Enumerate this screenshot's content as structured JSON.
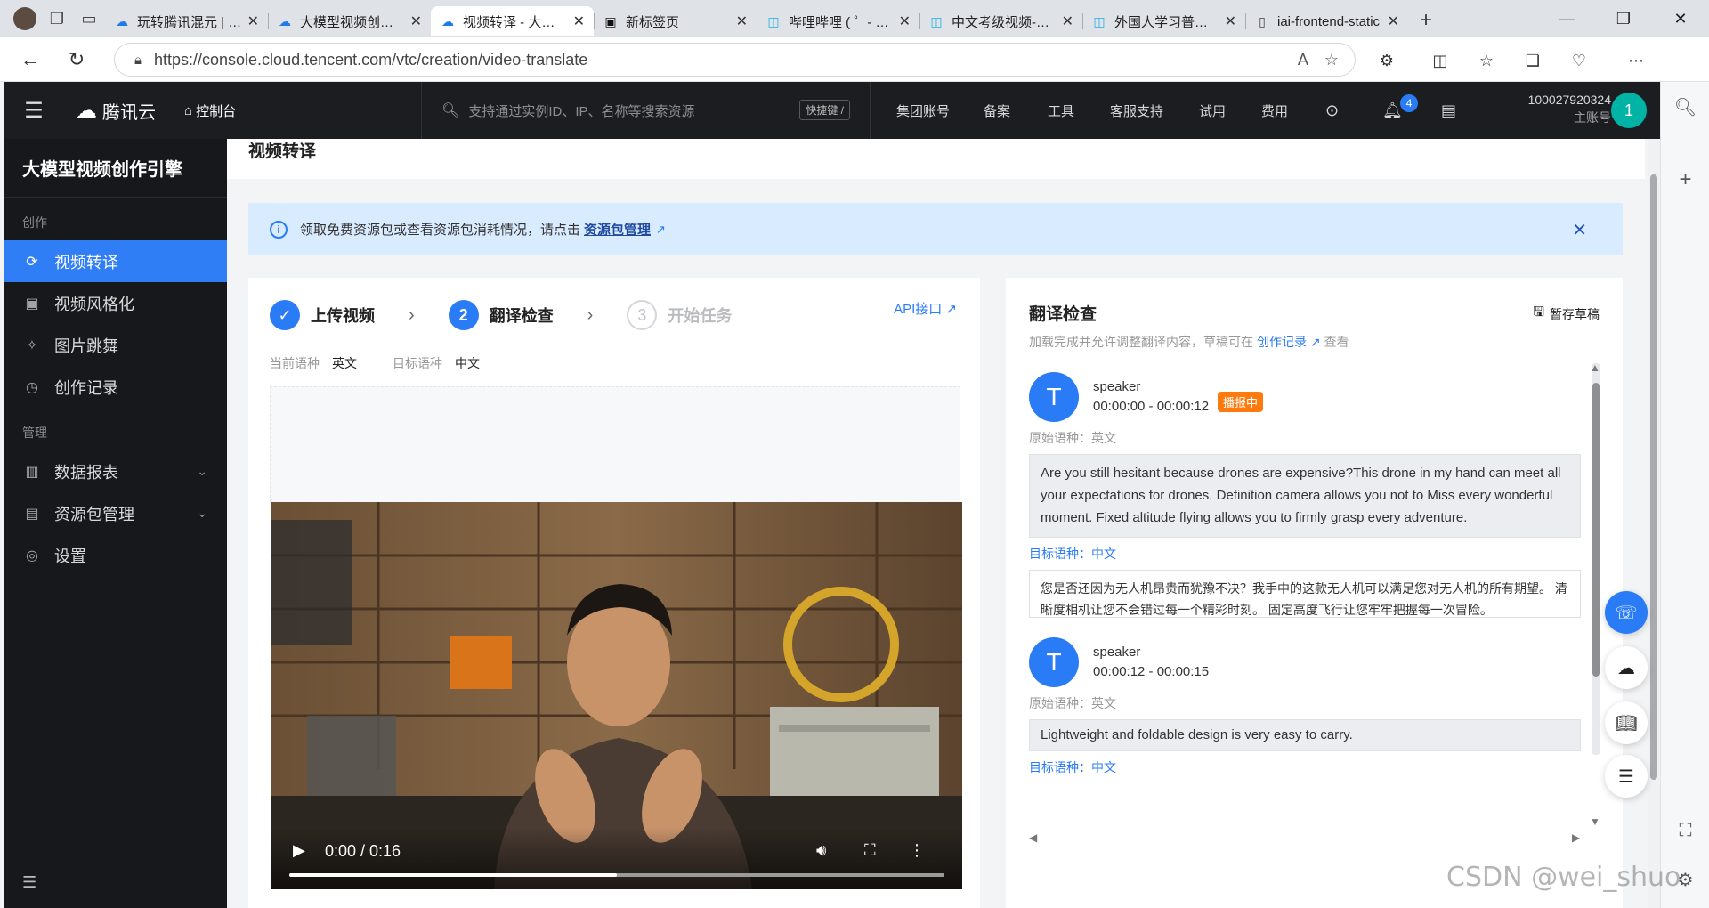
{
  "browser": {
    "tabs": [
      {
        "title": "玩转腾讯混元 | 腾讯云",
        "active": false
      },
      {
        "title": "大模型视频创作引擎",
        "active": false
      },
      {
        "title": "视频转译 - 大模型视频创作引擎",
        "active": true
      },
      {
        "title": "新标签页",
        "active": false
      },
      {
        "title": "哔哩哔哩 ( ゜- ゜)つロ",
        "active": false
      },
      {
        "title": "中文考级视频-哔哩哔哩",
        "active": false
      },
      {
        "title": "外国人学习普通话",
        "active": false
      },
      {
        "title": "iai-frontend-static",
        "active": false
      }
    ],
    "url": "https://console.cloud.tencent.com/vtc/creation/video-translate"
  },
  "header": {
    "logo_text": "腾讯云",
    "console_label": "控制台",
    "search_placeholder": "支持通过实例ID、IP、名称等搜索资源",
    "shortcut_label": "快捷键 /",
    "nav": [
      "集团账号",
      "备案",
      "工具",
      "客服支持",
      "试用",
      "费用"
    ],
    "notification_count": "4",
    "account_id": "100027920324",
    "account_role": "主账号",
    "avatar_letter": "1"
  },
  "sidebar": {
    "product_name": "大模型视频创作引擎",
    "group_create": "创作",
    "group_manage": "管理",
    "items": [
      {
        "label": "视频转译",
        "icon": "translate-icon",
        "active": true
      },
      {
        "label": "视频风格化",
        "icon": "video-style-icon",
        "active": false
      },
      {
        "label": "图片跳舞",
        "icon": "dance-icon",
        "active": false
      },
      {
        "label": "创作记录",
        "icon": "history-icon",
        "active": false
      },
      {
        "label": "数据报表",
        "icon": "bar-chart-icon",
        "active": false
      },
      {
        "label": "资源包管理",
        "icon": "package-icon",
        "active": false
      },
      {
        "label": "设置",
        "icon": "settings-icon",
        "active": false
      }
    ]
  },
  "page": {
    "title": "视频转译",
    "notice_text": "领取免费资源包或查看资源包消耗情况，请点击",
    "notice_link": "资源包管理"
  },
  "workflow": {
    "steps": [
      {
        "num": "✓",
        "label": "上传视频",
        "state": "done"
      },
      {
        "num": "2",
        "label": "翻译检查",
        "state": "current"
      },
      {
        "num": "3",
        "label": "开始任务",
        "state": "todo"
      }
    ],
    "api_link": "API接口",
    "source_lang_label": "当前语种",
    "source_lang": "英文",
    "target_lang_label": "目标语种",
    "target_lang": "中文"
  },
  "video": {
    "time": "0:00 / 0:16",
    "progress": 0.5
  },
  "translation": {
    "title": "翻译检查",
    "save_draft": "暂存草稿",
    "subtitle_prefix": "加载完成并允许调整翻译内容，草稿可在",
    "subtitle_link": "创作记录",
    "subtitle_suffix": "查看",
    "segments": [
      {
        "avatar": "T",
        "speaker": "speaker",
        "time": "00:00:00 - 00:00:12",
        "tag": "播报中",
        "source_label": "原始语种：英文",
        "source_text": "Are you still hesitant because drones are expensive?This drone in my hand can meet all your expectations for drones. Definition camera allows you not to Miss every wonderful moment. Fixed altitude flying allows you to firmly grasp every adventure.",
        "target_label": "目标语种：中文",
        "target_text": "您是否还因为无人机昂贵而犹豫不决？我手中的这款无人机可以满足您对无人机的所有期望。 清晰度相机让您不会错过每一个精彩时刻。 固定高度飞行让您牢牢把握每一次冒险。"
      },
      {
        "avatar": "T",
        "speaker": "speaker",
        "time": "00:00:12 - 00:00:15",
        "source_label": "原始语种：英文",
        "source_text": "Lightweight and foldable design is very easy to carry.",
        "target_label": "目标语种：中文"
      }
    ]
  },
  "watermark": "CSDN @wei_shuo",
  "colors": {
    "accent": "#2a7cf6",
    "header_bg": "#1b1d21",
    "sidebar_bg": "#16181c",
    "tag_orange": "#ff7a0c",
    "notice_bg": "#d9ebff"
  }
}
